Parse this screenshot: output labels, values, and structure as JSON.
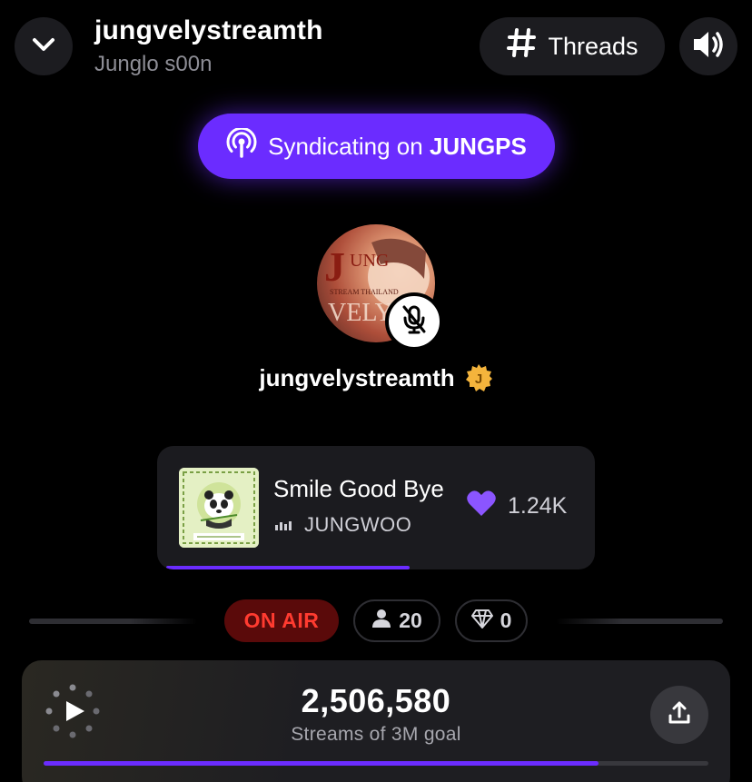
{
  "header": {
    "title": "jungvelystreamth",
    "subtitle": "Junglo s00n",
    "back_icon": "chevron-down-icon",
    "threads_label": "Threads",
    "threads_icon": "hash-icon",
    "sound_icon": "volume-icon"
  },
  "syndication": {
    "prefix": "Syndicating on",
    "target": "JUNGPS",
    "icon": "broadcast-icon",
    "color": "#6b2cff"
  },
  "host": {
    "name": "jungvelystreamth",
    "badge_letter": "J",
    "avatar_text": {
      "line1": "JUNG",
      "line2": "STREAM THAILAND",
      "line3": "VELY"
    },
    "muted": true
  },
  "now_playing": {
    "title": "Smile Good Bye",
    "artist": "JUNGWOO",
    "likes": "1.24K",
    "progress": 0.58
  },
  "room_status": {
    "live_label": "ON AIR",
    "listeners": "20",
    "gems": "0",
    "live_color": "#ff3b30"
  },
  "streams": {
    "count": "2,506,580",
    "subtitle": "Streams of 3M goal",
    "progress": 0.835
  }
}
